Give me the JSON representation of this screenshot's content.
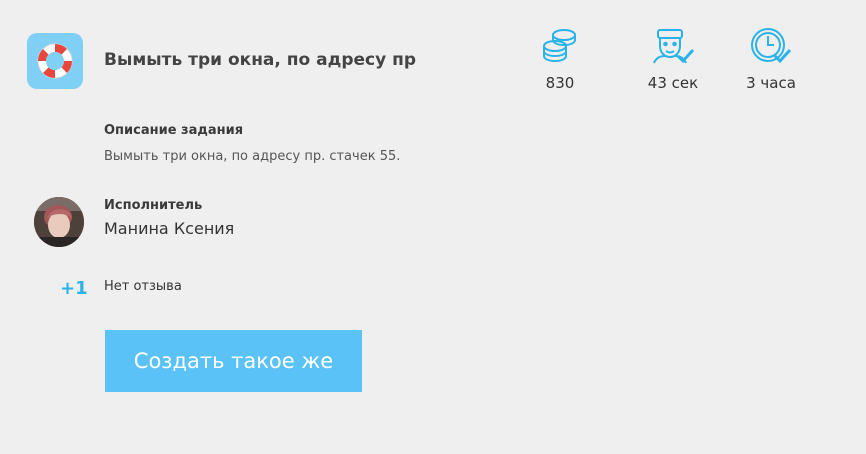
{
  "task": {
    "title": "Вымыть три окна, по адресу пр",
    "icon": "lifebuoy-icon"
  },
  "stats": [
    {
      "icon": "coins-icon",
      "value": "830"
    },
    {
      "icon": "person-check-icon",
      "value": "43 сек"
    },
    {
      "icon": "clock-check-icon",
      "value": "3 часа"
    }
  ],
  "description": {
    "label": "Описание задания",
    "text": "Вымыть три окна, по адресу пр. стачек 55."
  },
  "executor": {
    "label": "Исполнитель",
    "name": "Манина Ксения"
  },
  "review": {
    "badge": "+1",
    "text": "Нет отзыва"
  },
  "actions": {
    "create_label": "Создать такое же"
  },
  "colors": {
    "accent": "#5bc2f7",
    "icon_stroke": "#2ab3e8",
    "task_icon_bg": "#7fd0f4",
    "background": "#efefef"
  }
}
